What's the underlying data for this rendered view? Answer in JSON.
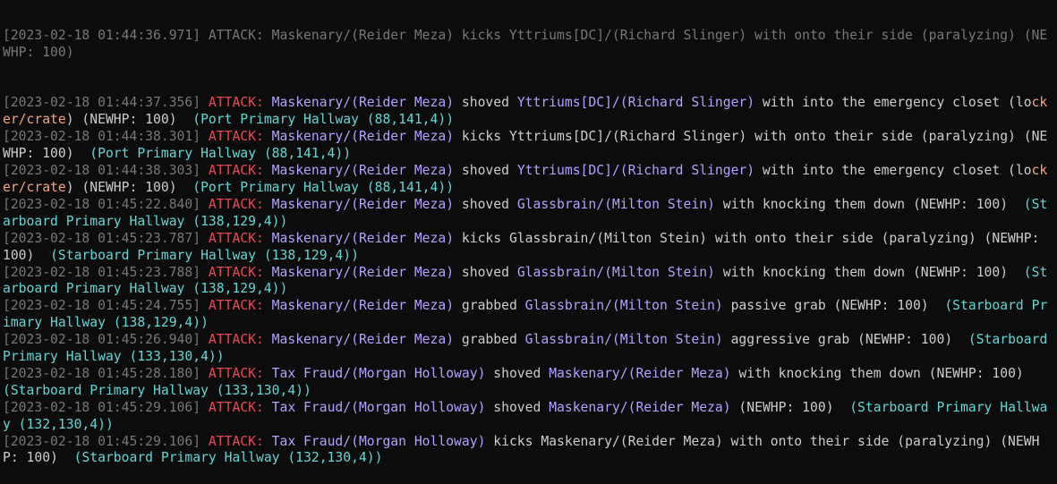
{
  "window": {
    "kind": "terminal-log"
  },
  "colors": {
    "background": "#0c0c0c",
    "timestamp": "#767676",
    "attack_tag": "#e74856",
    "player": "#b4a0ff",
    "location": "#61d6d6",
    "department": "#f9a27a",
    "text": "#cccccc"
  },
  "partial_top_line": "[2023-02-18 01:44:36.971] ATTACK: Maskenary/(Reider Meza) kicks Yttriums[DC]/(Richard Slinger) with onto their side (paralyzing) (NEWHP: 100)",
  "log": [
    {
      "segments": [
        {
          "t": "ts",
          "text": "[2023-02-18 01:44:37.356] "
        },
        {
          "t": "atk",
          "text": "ATTACK: "
        },
        {
          "t": "usr",
          "text": "Maskenary/(Reider Meza)"
        },
        {
          "t": "txt",
          "text": " shoved "
        },
        {
          "t": "usr",
          "text": "Yttriums[DC]/(Richard Slinger)"
        },
        {
          "t": "txt",
          "text": " with into the emergency closet (lo"
        },
        {
          "t": "dep",
          "text": "cker/crate"
        },
        {
          "t": "txt",
          "text": ") (NEWHP: 100)  "
        },
        {
          "t": "loc",
          "text": "(Port Primary Hallway (88,141,4))"
        }
      ]
    },
    {
      "segments": [
        {
          "t": "ts",
          "text": "[2023-02-18 01:44:38.301] "
        },
        {
          "t": "atk",
          "text": "ATTACK: "
        },
        {
          "t": "usr",
          "text": "Maskenary/(Reider Meza)"
        },
        {
          "t": "txt",
          "text": " kicks Yttriums[DC]/(Richard Slinger) with onto their side (paralyzing) (NEWHP: 100)  "
        },
        {
          "t": "loc",
          "text": "(Port Primary Hallway (88,141,4))"
        }
      ]
    },
    {
      "segments": [
        {
          "t": "ts",
          "text": "[2023-02-18 01:44:38.303] "
        },
        {
          "t": "atk",
          "text": "ATTACK: "
        },
        {
          "t": "usr",
          "text": "Maskenary/(Reider Meza)"
        },
        {
          "t": "txt",
          "text": " shoved "
        },
        {
          "t": "usr",
          "text": "Yttriums[DC]/(Richard Slinger)"
        },
        {
          "t": "txt",
          "text": " with into the emergency closet (lo"
        },
        {
          "t": "dep",
          "text": "cker/crate"
        },
        {
          "t": "txt",
          "text": ") (NEWHP: 100)  "
        },
        {
          "t": "loc",
          "text": "(Port Primary Hallway (88,141,4))"
        }
      ]
    },
    {
      "segments": [
        {
          "t": "ts",
          "text": "[2023-02-18 01:45:22.840] "
        },
        {
          "t": "atk",
          "text": "ATTACK: "
        },
        {
          "t": "usr",
          "text": "Maskenary/(Reider Meza)"
        },
        {
          "t": "txt",
          "text": " shoved "
        },
        {
          "t": "usr",
          "text": "Glassbrain/(Milton Stein)"
        },
        {
          "t": "txt",
          "text": " with knocking them down (NEWHP: 100)  "
        },
        {
          "t": "loc",
          "text": "(Starboard Primary Hallway (138,129,4))"
        }
      ]
    },
    {
      "segments": [
        {
          "t": "ts",
          "text": "[2023-02-18 01:45:23.787] "
        },
        {
          "t": "atk",
          "text": "ATTACK: "
        },
        {
          "t": "usr",
          "text": "Maskenary/(Reider Meza)"
        },
        {
          "t": "txt",
          "text": " kicks Glassbrain/(Milton Stein) with onto their side (paralyzing) (NEWHP: 100)  "
        },
        {
          "t": "loc",
          "text": "(Starboard Primary Hallway (138,129,4))"
        }
      ]
    },
    {
      "segments": [
        {
          "t": "ts",
          "text": "[2023-02-18 01:45:23.788] "
        },
        {
          "t": "atk",
          "text": "ATTACK: "
        },
        {
          "t": "usr",
          "text": "Maskenary/(Reider Meza)"
        },
        {
          "t": "txt",
          "text": " shoved "
        },
        {
          "t": "usr",
          "text": "Glassbrain/(Milton Stein)"
        },
        {
          "t": "txt",
          "text": " with knocking them down (NEWHP: 100)  "
        },
        {
          "t": "loc",
          "text": "(Starboard Primary Hallway (138,129,4))"
        }
      ]
    },
    {
      "segments": [
        {
          "t": "ts",
          "text": "[2023-02-18 01:45:24.755] "
        },
        {
          "t": "atk",
          "text": "ATTACK: "
        },
        {
          "t": "usr",
          "text": "Maskenary/(Reider Meza)"
        },
        {
          "t": "txt",
          "text": " grabbed "
        },
        {
          "t": "usr",
          "text": "Glassbrain/(Milton Stein)"
        },
        {
          "t": "txt",
          "text": " passive grab (NEWHP: 100)  "
        },
        {
          "t": "loc",
          "text": "(Starboard Primary Hallway (138,129,4))"
        }
      ]
    },
    {
      "segments": [
        {
          "t": "ts",
          "text": "[2023-02-18 01:45:26.940] "
        },
        {
          "t": "atk",
          "text": "ATTACK: "
        },
        {
          "t": "usr",
          "text": "Maskenary/(Reider Meza)"
        },
        {
          "t": "txt",
          "text": " grabbed "
        },
        {
          "t": "usr",
          "text": "Glassbrain/(Milton Stein)"
        },
        {
          "t": "txt",
          "text": " aggressive grab (NEWHP: 100)  "
        },
        {
          "t": "loc",
          "text": "(Starboard Primary Hallway (133,130,4))"
        }
      ]
    },
    {
      "segments": [
        {
          "t": "ts",
          "text": "[2023-02-18 01:45:28.180] "
        },
        {
          "t": "atk",
          "text": "ATTACK: "
        },
        {
          "t": "usr",
          "text": "Tax Fraud/(Morgan Holloway)"
        },
        {
          "t": "txt",
          "text": " shoved "
        },
        {
          "t": "usr",
          "text": "Maskenary/(Reider Meza)"
        },
        {
          "t": "txt",
          "text": " with knocking them down (NEWHP: 100)  "
        },
        {
          "t": "loc",
          "text": "(Starboard Primary Hallway (133,130,4))"
        }
      ]
    },
    {
      "segments": [
        {
          "t": "ts",
          "text": "[2023-02-18 01:45:29.106] "
        },
        {
          "t": "atk",
          "text": "ATTACK: "
        },
        {
          "t": "usr",
          "text": "Tax Fraud/(Morgan Holloway)"
        },
        {
          "t": "txt",
          "text": " shoved "
        },
        {
          "t": "usr",
          "text": "Maskenary/(Reider Meza)"
        },
        {
          "t": "txt",
          "text": " (NEWHP: 100)  "
        },
        {
          "t": "loc",
          "text": "(Starboard Primary Hallway (132,130,4))"
        }
      ]
    },
    {
      "segments": [
        {
          "t": "ts",
          "text": "[2023-02-18 01:45:29.106] "
        },
        {
          "t": "atk",
          "text": "ATTACK: "
        },
        {
          "t": "usr",
          "text": "Tax Fraud/(Morgan Holloway)"
        },
        {
          "t": "txt",
          "text": " kicks Maskenary/(Reider Meza) with onto their side (paralyzing) (NEWHP: 100)  "
        },
        {
          "t": "loc",
          "text": "(Starboard Primary Hallway (132,130,4))"
        }
      ]
    }
  ]
}
